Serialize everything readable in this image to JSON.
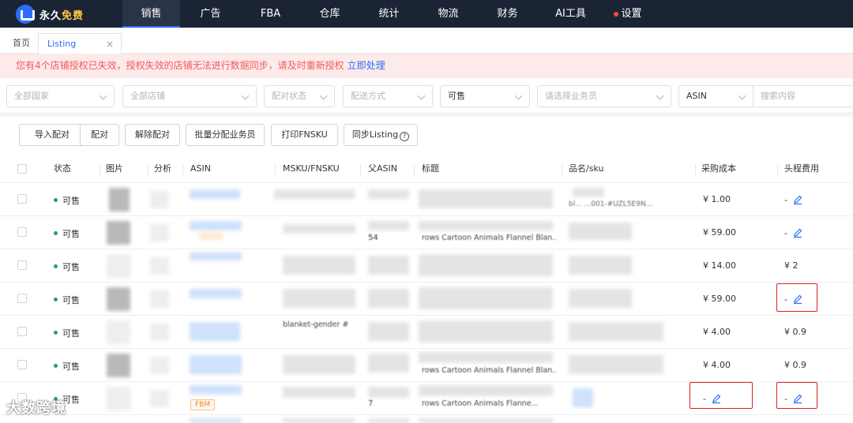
{
  "brand": {
    "part1": "永久",
    "part2": "免费"
  },
  "nav": [
    "销售",
    "广告",
    "FBA",
    "仓库",
    "统计",
    "物流",
    "财务",
    "AI工具",
    "设置"
  ],
  "tabs": {
    "home": "首页",
    "listing": "Listing",
    "close": "×"
  },
  "alert": {
    "text": "您有4个店铺授权已失效，授权失效的店铺无法进行数据同步，请及时重新授权",
    "link": "立即处理"
  },
  "filters": {
    "country": "全部国家",
    "store": "全部店铺",
    "match_status": "配对状态",
    "ship_method": "配送方式",
    "sale_status": "可售",
    "salesperson": "请选择业务员",
    "search_type": "ASIN",
    "search_placeholder": "搜索内容"
  },
  "actions": [
    "导入配对",
    "配对",
    "解除配对",
    "批量分配业务员",
    "打印FNSKU",
    "同步Listing"
  ],
  "columns": [
    "状态",
    "图片",
    "分析",
    "ASIN",
    "MSKU/FNSKU",
    "父ASIN",
    "标题",
    "品名/sku",
    "采购成本",
    "头程费用"
  ],
  "rows": [
    {
      "status": "可售",
      "cost": "¥ 1.00",
      "head_fee": "-",
      "head_edit": true,
      "parent_peek": "",
      "title_peek": "",
      "sku_peek": "bl... ...001-#UZL5E9N...",
      "msku_peek": ""
    },
    {
      "status": "可售",
      "cost": "¥ 59.00",
      "head_fee": "-",
      "head_edit": true,
      "parent_peek": "54",
      "title_peek": "rows Cartoon Animals Flannel Blan...",
      "sku_peek": "",
      "msku_peek": ""
    },
    {
      "status": "可售",
      "cost": "¥ 14.00",
      "head_fee": "¥ 2",
      "head_edit": false,
      "parent_peek": "",
      "title_peek": "",
      "sku_peek": "",
      "msku_peek": ""
    },
    {
      "status": "可售",
      "cost": "¥ 59.00",
      "head_fee": "-",
      "head_edit": true,
      "parent_peek": "",
      "title_peek": "",
      "sku_peek": "",
      "msku_peek": ""
    },
    {
      "status": "可售",
      "cost": "¥ 4.00",
      "head_fee": "¥ 0.9",
      "head_edit": false,
      "parent_peek": "",
      "title_peek": "",
      "sku_peek": "",
      "msku_peek": "blanket-gender #"
    },
    {
      "status": "可售",
      "cost": "¥ 4.00",
      "head_fee": "¥ 0.9",
      "head_edit": false,
      "parent_peek": "",
      "title_peek": "rows Cartoon Animals Flannel Blan...",
      "sku_peek": "",
      "msku_peek": ""
    },
    {
      "status": "可售",
      "cost": "-",
      "cost_edit": true,
      "head_fee": "-",
      "head_edit": true,
      "fbm": "FBM",
      "parent_peek": "7",
      "title_peek": "rows Cartoon Animals Flanne...",
      "sku_peek": "",
      "msku_peek": ""
    }
  ],
  "watermark": "大数跨境",
  "colors": {
    "nav_bg": "#1b2434",
    "accent": "#2d6cf6",
    "alert_bg": "#fdeaea",
    "alert_text": "#f25b5b",
    "status_dot": "#21a366",
    "highlight": "#e02020"
  }
}
